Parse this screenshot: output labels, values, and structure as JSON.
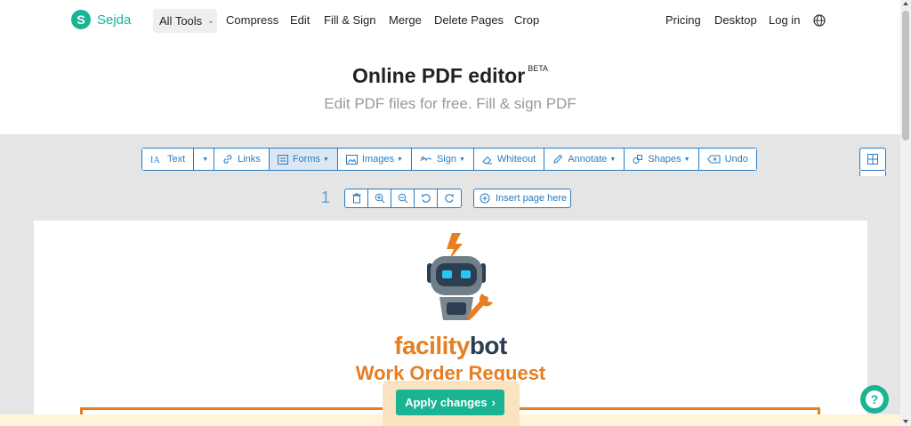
{
  "nav": {
    "logo_letter": "S",
    "brand": "Sejda",
    "all_tools": "All Tools",
    "links": [
      "Compress",
      "Edit",
      "Fill & Sign",
      "Merge",
      "Delete Pages",
      "Crop"
    ],
    "right_links": [
      "Pricing",
      "Desktop",
      "Log in"
    ],
    "globe_icon": "globe-icon"
  },
  "header": {
    "title": "Online PDF editor",
    "badge": "BETA",
    "subtitle": "Edit PDF files for free. Fill & sign PDF"
  },
  "toolbar": {
    "text": "Text",
    "links": "Links",
    "forms": "Forms",
    "images": "Images",
    "sign": "Sign",
    "whiteout": "Whiteout",
    "annotate": "Annotate",
    "shapes": "Shapes",
    "undo": "Undo",
    "active": "Forms"
  },
  "page_controls": {
    "page_number": "1",
    "insert_label": "Insert page here"
  },
  "document": {
    "brand_part1": "facility",
    "brand_part2": "bot",
    "heading": "Work Order Request"
  },
  "actions": {
    "apply": "Apply changes",
    "help": "?"
  },
  "colors": {
    "accent": "#1ab394",
    "toolbar_blue": "#2b7bbf",
    "doc_orange": "#e67e22",
    "doc_navy": "#2c3e50"
  }
}
